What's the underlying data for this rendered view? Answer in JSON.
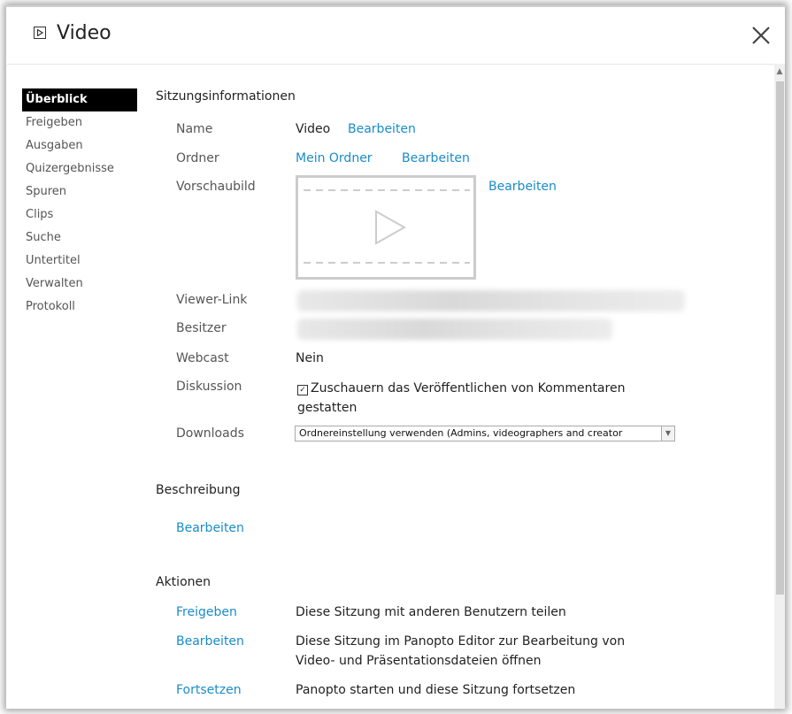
{
  "window": {
    "title": "Video",
    "title_icon": "play-box-icon",
    "close_icon": "close-icon"
  },
  "sidebar": {
    "items": [
      {
        "label": "Überblick",
        "active": true
      },
      {
        "label": "Freigeben"
      },
      {
        "label": "Ausgaben"
      },
      {
        "label": "Quizergebnisse"
      },
      {
        "label": "Spuren"
      },
      {
        "label": "Clips"
      },
      {
        "label": "Suche"
      },
      {
        "label": "Untertitel"
      },
      {
        "label": "Verwalten"
      },
      {
        "label": "Protokoll"
      }
    ]
  },
  "session": {
    "heading": "Sitzungsinformationen",
    "name_label": "Name",
    "name_value": "Video",
    "name_edit": "Bearbeiten",
    "folder_label": "Ordner",
    "folder_value": "Mein Ordner",
    "folder_edit": "Bearbeiten",
    "thumbnail_label": "Vorschaubild",
    "thumbnail_edit": "Bearbeiten",
    "viewer_link_label": "Viewer-Link",
    "owner_label": "Besitzer",
    "webcast_label": "Webcast",
    "webcast_value": "Nein",
    "discussion_label": "Diskussion",
    "discussion_checkbox_text": "Zuschauern das Veröffentlichen von Kommentaren gestatten",
    "discussion_checked": true,
    "downloads_label": "Downloads",
    "downloads_selected": "Ordnereinstellung verwenden (Admins, videographers and creator"
  },
  "description": {
    "heading": "Beschreibung",
    "edit": "Bearbeiten"
  },
  "actions": {
    "heading": "Aktionen",
    "items": [
      {
        "link": "Freigeben",
        "desc": "Diese Sitzung mit anderen Benutzern teilen"
      },
      {
        "link": "Bearbeiten",
        "desc": "Diese Sitzung im Panopto Editor zur Bearbeitung von Video- und Präsentationsdateien öffnen"
      },
      {
        "link": "Fortsetzen",
        "desc": "Panopto starten und diese Sitzung fortsetzen"
      }
    ]
  },
  "colors": {
    "link": "#1a8cc8",
    "active_nav_bg": "#000000"
  }
}
